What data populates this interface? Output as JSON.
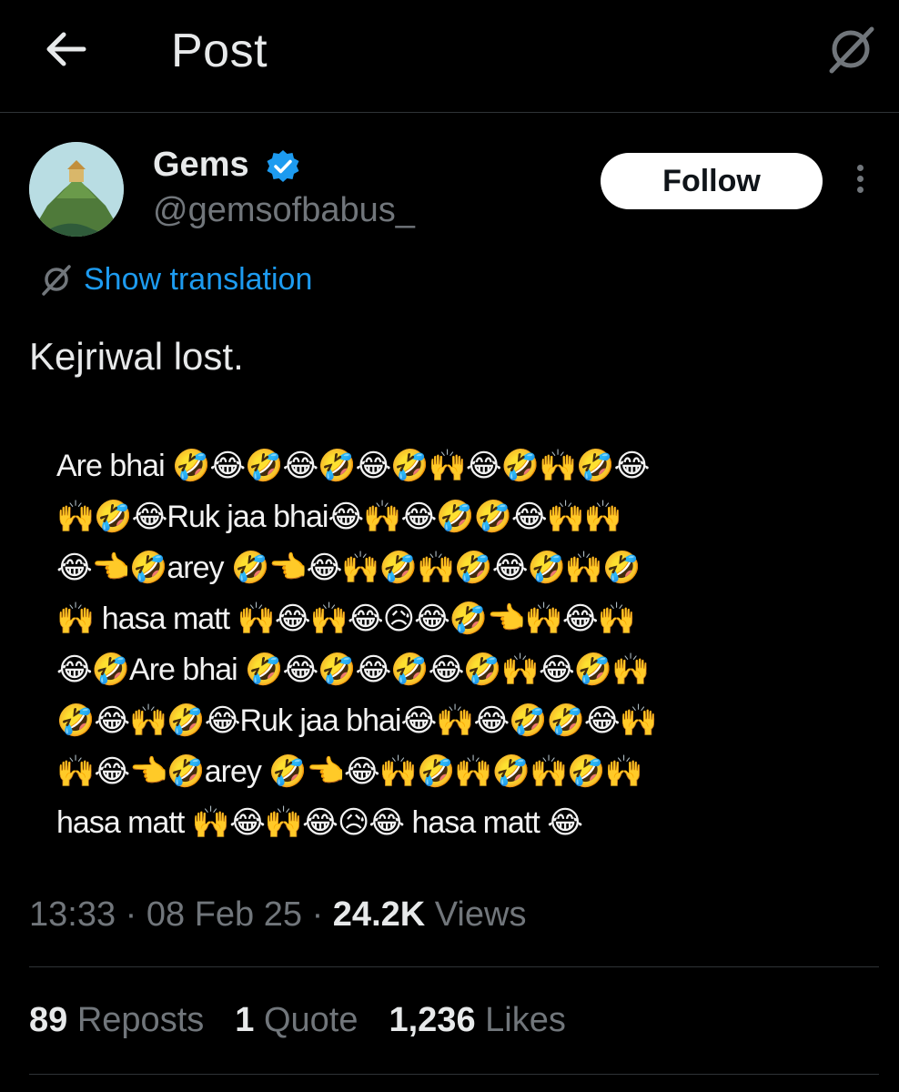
{
  "header": {
    "title": "Post"
  },
  "author": {
    "display_name": "Gems",
    "handle": "@gemsofbabus_",
    "follow_label": "Follow"
  },
  "translation": {
    "label": "Show translation"
  },
  "post": {
    "text": "Kejriwal lost.",
    "image_lines": [
      "Are bhai 🤣😂🤣😂🤣😂🤣🙌😂🤣🙌🤣😂",
      "🙌🤣😂Ruk jaa bhai😂🙌😂🤣🤣😂🙌🙌",
      "😂👈🤣arey 🤣👈😂🙌🤣🙌🤣😂🤣🙌🤣",
      "🙌 hasa matt 🙌😂🙌😂😥😂🤣👈🙌😂🙌",
      "😂🤣Are bhai 🤣😂🤣😂🤣😂🤣🙌😂🤣🙌",
      "🤣😂🙌🤣😂Ruk jaa bhai😂🙌😂🤣🤣😂🙌",
      "🙌😂👈🤣arey 🤣👈😂🙌🤣🙌🤣🙌🤣🙌",
      "hasa matt 🙌😂🙌😂😥😂 hasa matt 😂"
    ]
  },
  "meta": {
    "time": "13:33",
    "sep1": " · ",
    "date": "08 Feb 25",
    "sep2": " · ",
    "views_count": "24.2K",
    "views_label": "Views"
  },
  "stats": {
    "reposts_count": "89",
    "reposts_label": "Reposts",
    "quotes_count": "1",
    "quotes_label": "Quote",
    "likes_count": "1,236",
    "likes_label": "Likes"
  },
  "icons": {
    "back": "back-arrow-icon",
    "grok": "grok-icon",
    "verified": "verified-badge-icon",
    "more": "more-options-icon",
    "translate": "translate-icon"
  },
  "colors": {
    "background": "#000000",
    "accent": "#1d9bf0",
    "text_primary": "#e7e9ea",
    "text_secondary": "#71767b"
  }
}
